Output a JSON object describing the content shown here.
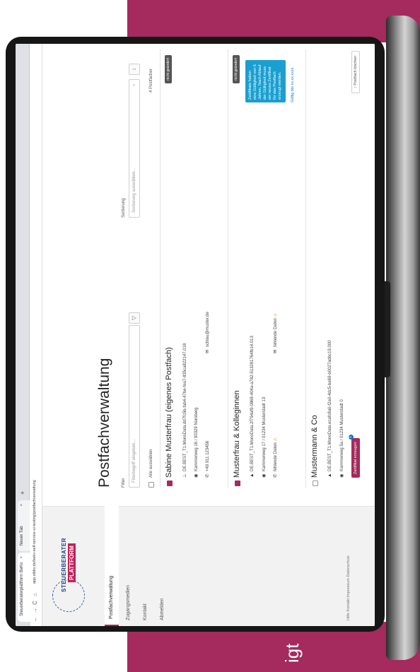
{
  "caption": "igt",
  "browser": {
    "tabs": [
      {
        "label": "Steuerberaterplattform BeKo"
      },
      {
        "label": "Neuer Tab"
      }
    ],
    "tab_close": "×",
    "new_tab": "+",
    "nav": {
      "back": "←",
      "forward": "→",
      "reload": "C",
      "home": "⌂"
    },
    "url": "app.stbkv.de/bekv-self-service-ui-testing/postfachverwaltung"
  },
  "sidebar": {
    "logo_line1": "STEUERBERATER",
    "logo_line2": "PLATTFORM",
    "items": [
      {
        "label": "Postfachverwaltung"
      },
      {
        "label": "Zugangsmedien"
      },
      {
        "label": "Kontakt"
      },
      {
        "label": "Abmelden"
      }
    ],
    "footer": "Hilfe  Kontakt  Impressum  Datenschutz"
  },
  "main": {
    "title": "Postfachverwaltung",
    "filter_label": "Filter",
    "filter_placeholder": "Filterbegriff eingeben...",
    "filter_icon": "▽",
    "sort_label": "Sortierung",
    "sort_placeholder": "Sortierung auswählen...",
    "sort_chevron": "⌄",
    "sort_dir": "↕",
    "select_all": "Alle auswählen",
    "count": "4 Postfächer",
    "icons": {
      "id": "⊥",
      "pin": "◉",
      "phone": "✆",
      "mail": "✉",
      "lock": "▲",
      "warn": "⚠"
    }
  },
  "cards": [
    {
      "title": "Sabine Musterfrau (eigenes Postfach)",
      "badge": "nicht geändert",
      "checked": true,
      "id": "DE.BEST_T1.MonoData.dd7fc5b-fab4-47be-fea7-835ca822147.018",
      "address": "Kammerweg 16 / 90329 Nürnberg",
      "phone": "+49 911 123456",
      "email": "schlau@muster.de"
    },
    {
      "title": "Musterfrau & Kolleginnen",
      "badge": "nicht geändert",
      "checked": true,
      "id": "DE.BEST_T1.MonoData.2f794af9-0868-404a-a782-513281764fb14.013",
      "address": "Kammerweg 17 / 01234 Musterstadt 13",
      "phone_missing": "fehlende Daten",
      "email_missing": "fehlende Daten",
      "tooltip": "Zertifikate haben eine Gültigkeit von 5 Jahren. Nach Ablauf der Gültigkeit muss ein neues Zertifikat für das Postfach erzeugt werden.",
      "validity": "Gültig bis xx.xx.xxxx"
    },
    {
      "title": "Mustermann & Co",
      "checked": false,
      "id": "DE.BEST_T1.MonoData.ecafc8a0-f2a0-4dc5-be69-b0027adbc19.000",
      "address": "Kammerweg 5a / 01234 Musterstadt 0",
      "cert_button": "Zertifikat erzeugen",
      "cert_badge": "1",
      "action_button": "Postfach löschen",
      "action_icon": "↑"
    }
  ]
}
